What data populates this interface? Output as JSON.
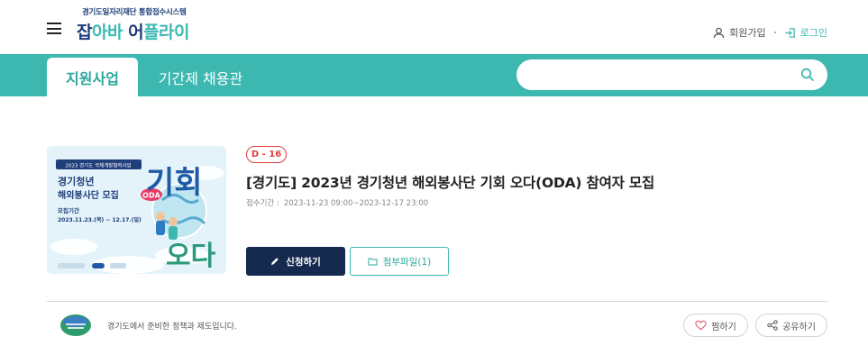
{
  "header": {
    "logo_sub": "경기도일자리재단 통합접수시스템",
    "logo_part1": "잡",
    "logo_part2": "아바",
    "logo_part3": " 어",
    "logo_part4": "플",
    "logo_part5": "라이",
    "signup_label": "회원가입",
    "login_label": "로그인"
  },
  "nav": {
    "tabs": [
      {
        "label": "지원사업",
        "active": true
      },
      {
        "label": "기간제 채용관",
        "active": false
      }
    ],
    "search_value": "",
    "search_placeholder": ""
  },
  "program": {
    "dday": "D - 16",
    "title": "[경기도] 2023년 경기청년 해외봉사단 기회 오다(ODA) 참여자 모집",
    "period_label": "접수기간 :",
    "period_value": "2023-11-23 09:00~2023-12-17 23:00",
    "apply_label": "신청하기",
    "attach_label": "첨부파일(1)",
    "poster": {
      "tag": "2023 경기도 국제개발협력사업",
      "headline1": "경기청년",
      "headline2": "해외봉사단 모집",
      "period_title": "모집기간",
      "period_dates": "2023.11.23.(목) ~ 12.17.(일)",
      "big_text1": "기회",
      "big_text2": "오다",
      "oda": "ODA"
    }
  },
  "footer": {
    "policy_text": "경기도에서 준비한 정책과 제도입니다.",
    "like_label": "찜하기",
    "share_label": "공유하기"
  },
  "colors": {
    "teal": "#3cb8b0",
    "navy": "#16294f",
    "dday_red": "#e03a3a"
  }
}
